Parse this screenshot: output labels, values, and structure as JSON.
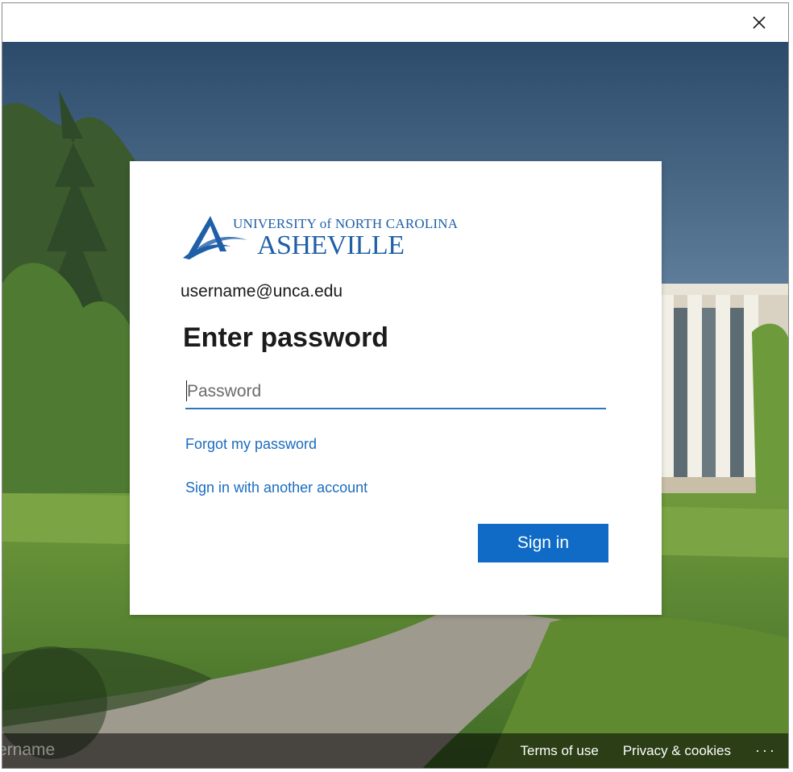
{
  "window": {
    "close_label": "×"
  },
  "logo": {
    "line1": "UNIVERSITY of NORTH CAROLINA",
    "line2": "ASHEVILLE"
  },
  "identity": "username@unca.edu",
  "title": "Enter password",
  "password": {
    "placeholder": "Password",
    "value": ""
  },
  "links": {
    "forgot": "Forgot my password",
    "another": "Sign in with another account"
  },
  "signin_label": "Sign in",
  "footer": {
    "ghost_text": "ername",
    "terms": "Terms of use",
    "privacy": "Privacy & cookies",
    "more": "···"
  },
  "colors": {
    "accent": "#0f6bc6",
    "link": "#1a6cc0",
    "logo": "#1f5fa8"
  },
  "icons": [
    "close-icon",
    "unca-logo-icon"
  ]
}
